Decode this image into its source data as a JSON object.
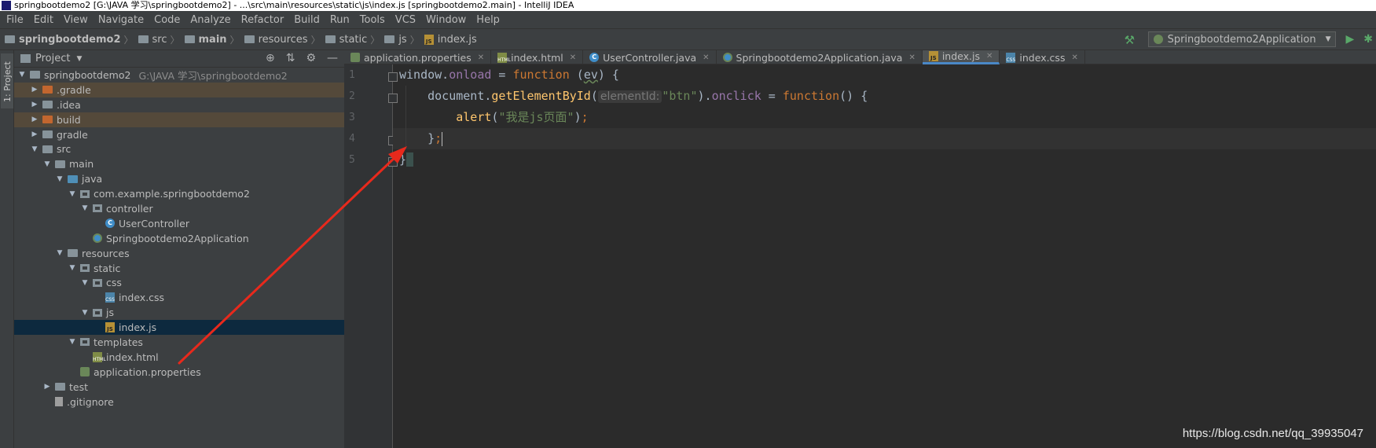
{
  "window": {
    "title": "springbootdemo2 [G:\\JAVA 学习\\springbootdemo2] - ...\\src\\main\\resources\\static\\js\\index.js [springbootdemo2.main] - IntelliJ IDEA"
  },
  "menu": [
    "File",
    "Edit",
    "View",
    "Navigate",
    "Code",
    "Analyze",
    "Refactor",
    "Build",
    "Run",
    "Tools",
    "VCS",
    "Window",
    "Help"
  ],
  "breadcrumbs": [
    "springbootdemo2",
    "src",
    "main",
    "resources",
    "static",
    "js",
    "index.js"
  ],
  "run_config": {
    "label": "Springbootdemo2Application"
  },
  "project_panel": {
    "title": "Project",
    "root_label": "springbootdemo2",
    "root_path": "G:\\JAVA 学习\\springbootdemo2",
    "nodes": [
      ".gradle",
      ".idea",
      "build",
      "gradle",
      "src",
      "main",
      "java",
      "com.example.springbootdemo2",
      "controller",
      "UserController",
      "Springbootdemo2Application",
      "resources",
      "static",
      "css",
      "index.css",
      "js",
      "index.js",
      "templates",
      "index.html",
      "application.properties",
      "test",
      ".gitignore"
    ]
  },
  "stripe": {
    "label": "1: Project"
  },
  "tabs": [
    {
      "label": "application.properties",
      "active": false
    },
    {
      "label": "index.html",
      "active": false
    },
    {
      "label": "UserController.java",
      "active": false
    },
    {
      "label": "Springbootdemo2Application.java",
      "active": false
    },
    {
      "label": "index.js",
      "active": true
    },
    {
      "label": "index.css",
      "active": false
    }
  ],
  "editor": {
    "line_numbers": [
      "1",
      "2",
      "3",
      "4",
      "5"
    ],
    "code": {
      "l1_a": "window.",
      "l1_b": "onload",
      "l1_c": " = ",
      "l1_d": "function",
      "l1_e": " (",
      "l1_f": "ev",
      "l1_g": ") {",
      "l2_a": "    document.",
      "l2_b": "getElementById",
      "l2_c": "(",
      "l2_hint": "elementId:",
      "l2_d": "\"btn\"",
      "l2_e": ").",
      "l2_f": "onclick",
      "l2_g": " = ",
      "l2_h": "function",
      "l2_i": "() {",
      "l3_a": "        ",
      "l3_b": "alert",
      "l3_c": "(",
      "l3_d": "\"我是js页面\"",
      "l3_e": ")",
      "l3_f": ";",
      "l4_a": "    }",
      "l4_b": ";",
      "l5_a": "}"
    }
  },
  "colors": {
    "annotation_arrow": "#e8291c",
    "accent": "#4a88c7"
  },
  "watermark": "https://blog.csdn.net/qq_39935047"
}
